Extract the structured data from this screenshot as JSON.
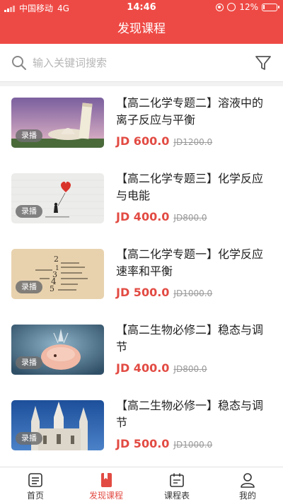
{
  "status": {
    "carrier": "中国移动",
    "network": "4G",
    "time": "14:46",
    "battery": "12%",
    "battery_level": 0.12
  },
  "header": {
    "title": "发现课程"
  },
  "search": {
    "placeholder": "输入关键词搜索",
    "icon": "search-icon",
    "filter_icon": "filter-icon"
  },
  "courses": [
    {
      "tag": "录播",
      "title": "【高二化学专题二】溶液中的离子反应与平衡",
      "price": "JD 600.0",
      "old_price": "JD1200.0",
      "image": "leaning-tower-photo"
    },
    {
      "tag": "录播",
      "title": "【高二化学专题三】化学反应与电能",
      "price": "JD 400.0",
      "old_price": "JD800.0",
      "image": "balloon-girl-artwork"
    },
    {
      "tag": "录播",
      "title": "【高二化学专题一】化学反应速率和平衡",
      "price": "JD 500.0",
      "old_price": "JD1000.0",
      "image": "number-typography-art"
    },
    {
      "tag": "录播",
      "title": "【高二生物必修二】稳态与调节",
      "price": "JD 400.0",
      "old_price": "JD800.0",
      "image": "piggy-bank-illustration"
    },
    {
      "tag": "录播",
      "title": "【高二生物必修一】稳态与调节",
      "price": "JD 500.0",
      "old_price": "JD1000.0",
      "image": "cathedral-photo"
    }
  ],
  "tabs": [
    {
      "label": "首页",
      "icon": "home-icon",
      "active": false
    },
    {
      "label": "发现课程",
      "icon": "bookmark-book-icon",
      "active": true
    },
    {
      "label": "课程表",
      "icon": "schedule-icon",
      "active": false
    },
    {
      "label": "我的",
      "icon": "user-icon",
      "active": false
    }
  ],
  "colors": {
    "accent": "#ee4a45",
    "price": "#e24b43"
  }
}
